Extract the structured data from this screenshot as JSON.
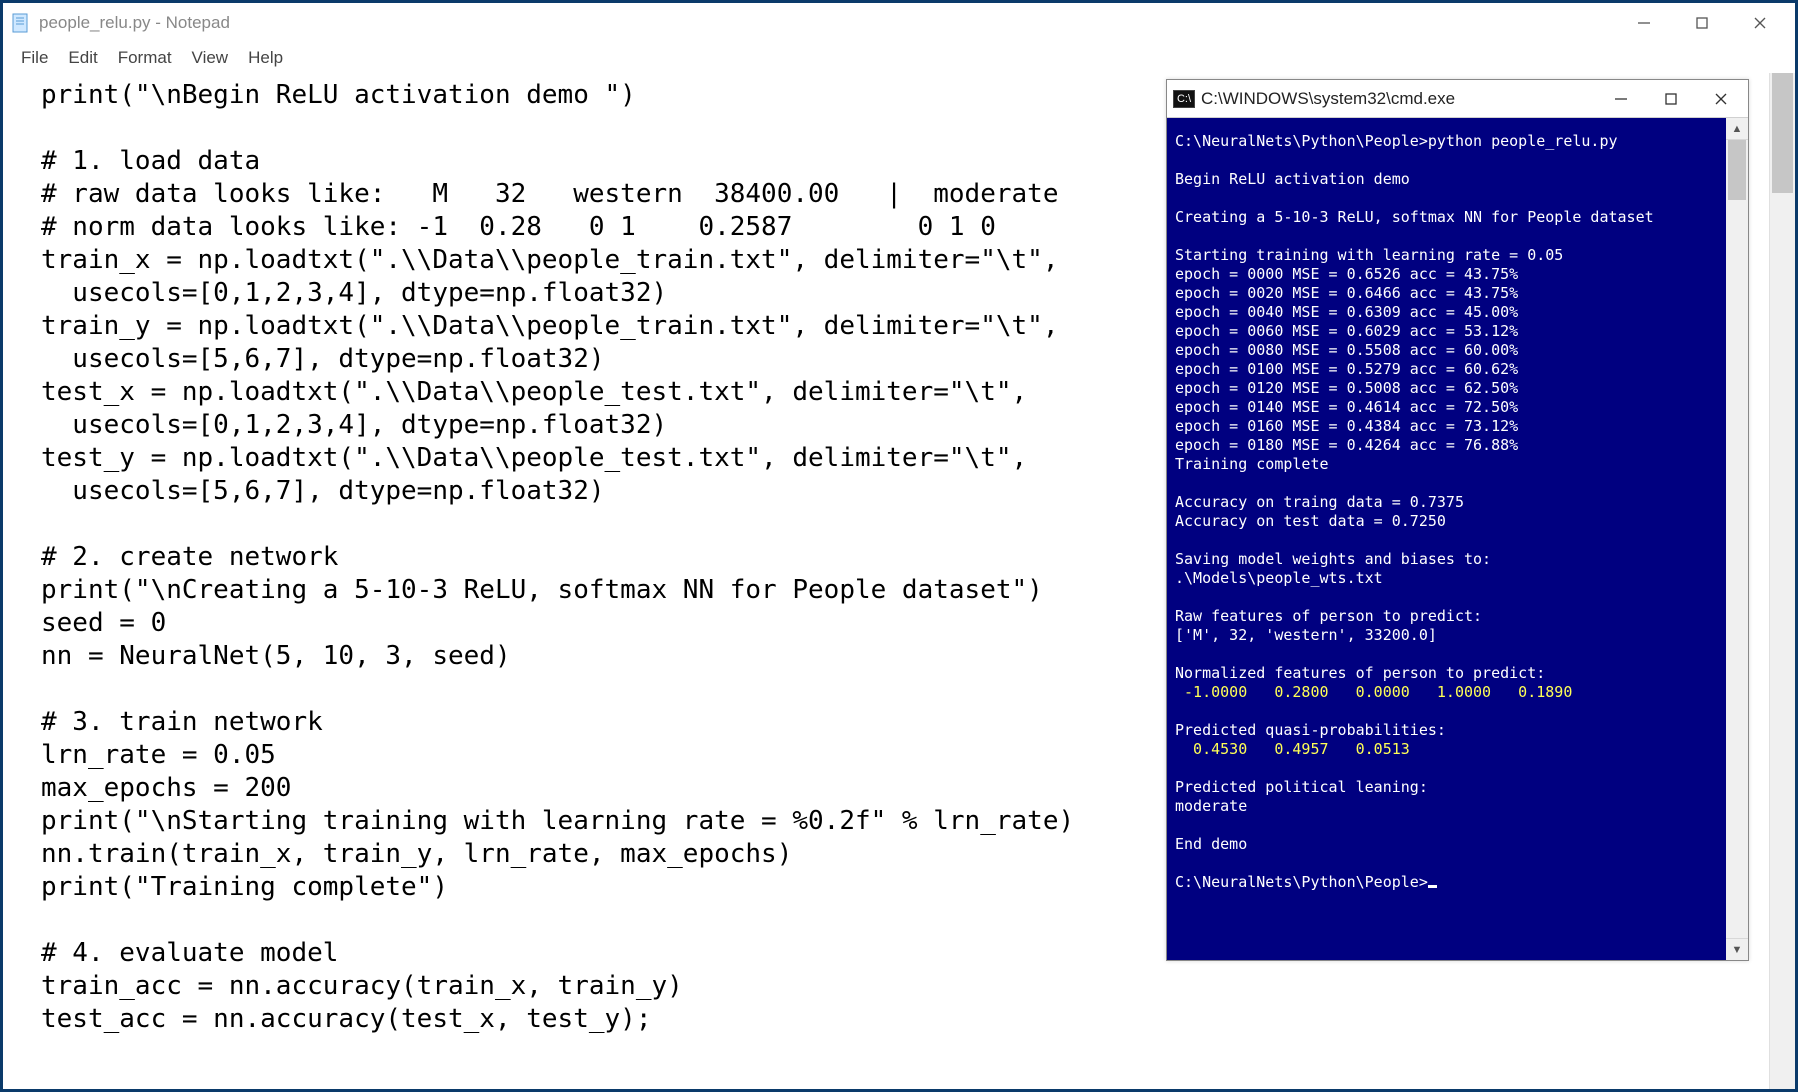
{
  "notepad": {
    "title": "people_relu.py - Notepad",
    "menus": [
      "File",
      "Edit",
      "Format",
      "View",
      "Help"
    ],
    "code_lines": [
      "print(\"\\nBegin ReLU activation demo \")",
      "",
      "# 1. load data",
      "# raw data looks like:   M   32   western  38400.00   |  moderate",
      "# norm data looks like: -1  0.28   0 1    0.2587        0 1 0",
      "train_x = np.loadtxt(\".\\\\Data\\\\people_train.txt\", delimiter=\"\\t\",",
      "  usecols=[0,1,2,3,4], dtype=np.float32)",
      "train_y = np.loadtxt(\".\\\\Data\\\\people_train.txt\", delimiter=\"\\t\",",
      "  usecols=[5,6,7], dtype=np.float32)",
      "test_x = np.loadtxt(\".\\\\Data\\\\people_test.txt\", delimiter=\"\\t\",",
      "  usecols=[0,1,2,3,4], dtype=np.float32)",
      "test_y = np.loadtxt(\".\\\\Data\\\\people_test.txt\", delimiter=\"\\t\",",
      "  usecols=[5,6,7], dtype=np.float32)",
      "",
      "# 2. create network",
      "print(\"\\nCreating a 5-10-3 ReLU, softmax NN for People dataset\")",
      "seed = 0",
      "nn = NeuralNet(5, 10, 3, seed)",
      "",
      "# 3. train network",
      "lrn_rate = 0.05",
      "max_epochs = 200",
      "print(\"\\nStarting training with learning rate = %0.2f\" % lrn_rate)",
      "nn.train(train_x, train_y, lrn_rate, max_epochs)",
      "print(\"Training complete\")",
      "",
      "# 4. evaluate model",
      "train_acc = nn.accuracy(train_x, train_y)",
      "test_acc = nn.accuracy(test_x, test_y);"
    ]
  },
  "cmd": {
    "title": "C:\\WINDOWS\\system32\\cmd.exe",
    "prompt_path": "C:\\NeuralNets\\Python\\People>",
    "segments": [
      {
        "text": "C:\\NeuralNets\\Python\\People>python people_relu.py",
        "color": "white"
      },
      {
        "text": "",
        "color": "white"
      },
      {
        "text": "Begin ReLU activation demo",
        "color": "white"
      },
      {
        "text": "",
        "color": "white"
      },
      {
        "text": "Creating a 5-10-3 ReLU, softmax NN for People dataset",
        "color": "white"
      },
      {
        "text": "",
        "color": "white"
      },
      {
        "text": "Starting training with learning rate = 0.05",
        "color": "white"
      },
      {
        "text": "epoch = 0000 MSE = 0.6526 acc = 43.75%",
        "color": "white"
      },
      {
        "text": "epoch = 0020 MSE = 0.6466 acc = 43.75%",
        "color": "white"
      },
      {
        "text": "epoch = 0040 MSE = 0.6309 acc = 45.00%",
        "color": "white"
      },
      {
        "text": "epoch = 0060 MSE = 0.6029 acc = 53.12%",
        "color": "white"
      },
      {
        "text": "epoch = 0080 MSE = 0.5508 acc = 60.00%",
        "color": "white"
      },
      {
        "text": "epoch = 0100 MSE = 0.5279 acc = 60.62%",
        "color": "white"
      },
      {
        "text": "epoch = 0120 MSE = 0.5008 acc = 62.50%",
        "color": "white"
      },
      {
        "text": "epoch = 0140 MSE = 0.4614 acc = 72.50%",
        "color": "white"
      },
      {
        "text": "epoch = 0160 MSE = 0.4384 acc = 73.12%",
        "color": "white"
      },
      {
        "text": "epoch = 0180 MSE = 0.4264 acc = 76.88%",
        "color": "white"
      },
      {
        "text": "Training complete",
        "color": "white"
      },
      {
        "text": "",
        "color": "white"
      },
      {
        "text": "Accuracy on traing data = 0.7375",
        "color": "white"
      },
      {
        "text": "Accuracy on test data = 0.7250",
        "color": "white"
      },
      {
        "text": "",
        "color": "white"
      },
      {
        "text": "Saving model weights and biases to:",
        "color": "white"
      },
      {
        "text": ".\\Models\\people_wts.txt",
        "color": "white"
      },
      {
        "text": "",
        "color": "white"
      },
      {
        "text": "Raw features of person to predict:",
        "color": "white"
      },
      {
        "text": "['M', 32, 'western', 33200.0]",
        "color": "white"
      },
      {
        "text": "",
        "color": "white"
      },
      {
        "text": "Normalized features of person to predict:",
        "color": "white"
      },
      {
        "text": " -1.0000   0.2800   0.0000   1.0000   0.1890",
        "color": "yellow"
      },
      {
        "text": "",
        "color": "white"
      },
      {
        "text": "Predicted quasi-probabilities:",
        "color": "white"
      },
      {
        "text": "  0.4530   0.4957   0.0513",
        "color": "yellow"
      },
      {
        "text": "",
        "color": "white"
      },
      {
        "text": "Predicted political leaning:",
        "color": "white"
      },
      {
        "text": "moderate",
        "color": "white"
      },
      {
        "text": "",
        "color": "white"
      },
      {
        "text": "End demo",
        "color": "white"
      },
      {
        "text": "",
        "color": "white"
      }
    ]
  }
}
